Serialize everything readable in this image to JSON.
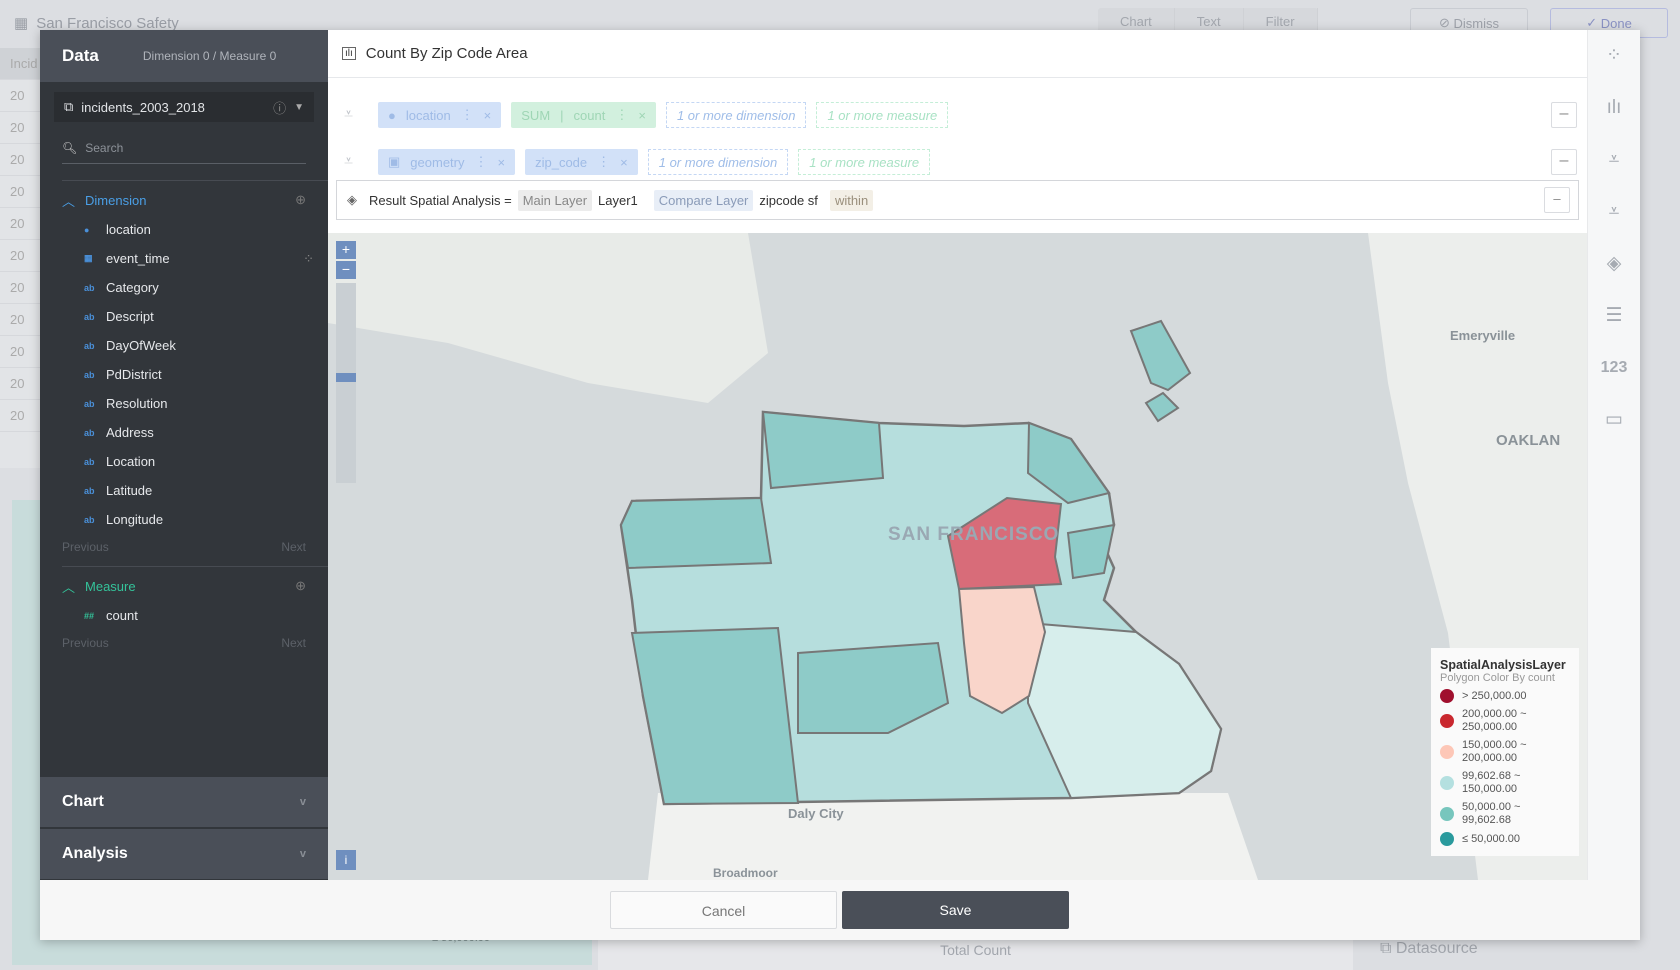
{
  "background": {
    "title": "San Francisco Safety",
    "side_header": "Incid",
    "rows": [
      "20",
      "20",
      "20",
      "20",
      "20",
      "20",
      "20",
      "20",
      "20",
      "20",
      "20",
      "20"
    ],
    "toolbar": [
      "Chart",
      "Text",
      "Filter"
    ],
    "dismiss": "Dismiss",
    "done": "Done",
    "total_count": "Total Count",
    "datasource": "Datasource",
    "legend_fragment": "≤ 50,000.00"
  },
  "data_panel": {
    "title": "Data",
    "summary": "Dimension 0 / Measure 0",
    "datasource": "incidents_2003_2018",
    "search_placeholder": "Search",
    "dimension_label": "Dimension",
    "dimensions": [
      {
        "icon": "pin",
        "label": "location"
      },
      {
        "icon": "cal",
        "label": "event_time"
      },
      {
        "icon": "ab",
        "label": "Category"
      },
      {
        "icon": "ab",
        "label": "Descript"
      },
      {
        "icon": "ab",
        "label": "DayOfWeek"
      },
      {
        "icon": "ab",
        "label": "PdDistrict"
      },
      {
        "icon": "ab",
        "label": "Resolution"
      },
      {
        "icon": "ab",
        "label": "Address"
      },
      {
        "icon": "ab",
        "label": "Location"
      },
      {
        "icon": "ab",
        "label": "Latitude"
      },
      {
        "icon": "ab",
        "label": "Longitude"
      }
    ],
    "measure_label": "Measure",
    "measures": [
      {
        "icon": "##",
        "label": "count"
      }
    ],
    "previous": "Previous",
    "next": "Next",
    "chart_section": "Chart",
    "analysis_section": "Analysis"
  },
  "main": {
    "title": "Count By Zip Code Area",
    "layer1": {
      "dimension": "location",
      "agg": "SUM",
      "measure": "count",
      "dim_ph": "1 or more dimension",
      "mea_ph": "1 or more measure"
    },
    "layer2": {
      "dimension": "geometry",
      "dimension2": "zip_code",
      "dim_ph": "1 or more dimension",
      "mea_ph": "1 or more measure"
    },
    "analysis": {
      "label": "Result Spatial Analysis =",
      "main_tag": "Main Layer",
      "main_value": "Layer1",
      "compare_tag": "Compare Layer",
      "compare_value": "zipcode sf",
      "op": "within"
    }
  },
  "map": {
    "labels": {
      "city": "SAN FRANCISCO",
      "emeryville": "Emeryville",
      "oakland": "OAKLAN",
      "daly": "Daly City",
      "broadmoor": "Broadmoor"
    },
    "legend": {
      "title": "SpatialAnalysisLayer",
      "subtitle": "Polygon Color By count",
      "items": [
        {
          "label": "> 250,000.00",
          "color": "#a0102e"
        },
        {
          "label": "200,000.00 ~ 250,000.00",
          "color": "#c9282f"
        },
        {
          "label": "150,000.00 ~ 200,000.00",
          "color": "#fdc7b7"
        },
        {
          "label": "99,602.68 ~ 150,000.00",
          "color": "#b4e0e0"
        },
        {
          "label": "50,000.00 ~ 99,602.68",
          "color": "#77c6bd"
        },
        {
          "label": "≤ 50,000.00",
          "color": "#2a9a9d"
        }
      ]
    }
  },
  "right_bar": {
    "number_icon": "123"
  },
  "footer": {
    "cancel": "Cancel",
    "save": "Save"
  }
}
